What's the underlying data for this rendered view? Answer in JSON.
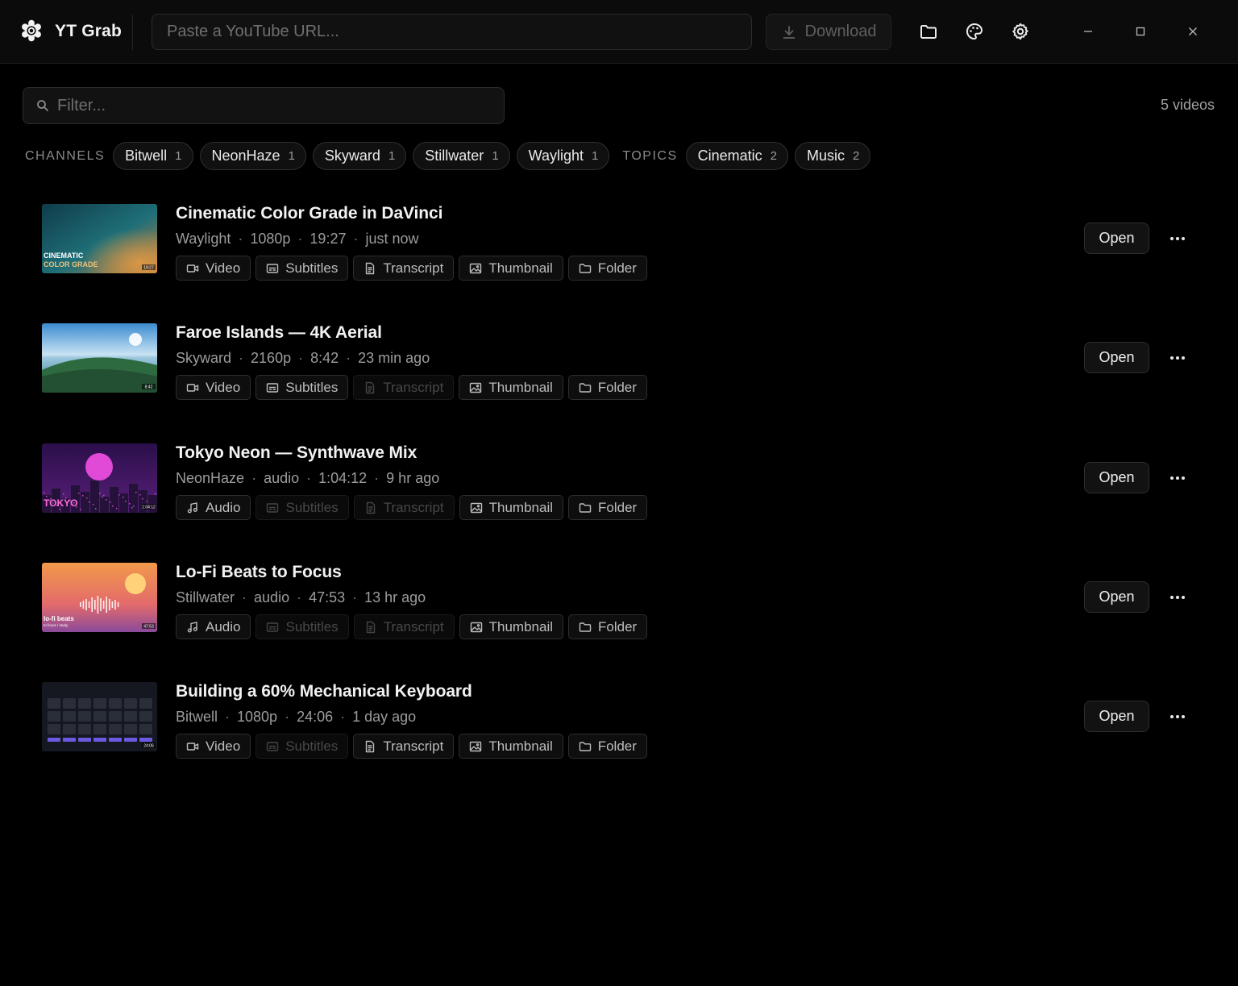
{
  "app": {
    "name": "YT Grab",
    "logo_icon": "gear-flower-logo-icon"
  },
  "toolbar": {
    "url_placeholder": "Paste a YouTube URL...",
    "url_value": "",
    "download_label": "Download",
    "icons": [
      "folder-icon",
      "palette-icon",
      "gear-icon"
    ]
  },
  "window_controls": [
    "minimize-icon",
    "maximize-icon",
    "close-icon"
  ],
  "filter": {
    "placeholder": "Filter...",
    "value": "",
    "count_label": "5 videos"
  },
  "chips": {
    "channels_label": "CHANNELS",
    "channels": [
      {
        "label": "Bitwell",
        "count": "1"
      },
      {
        "label": "NeonHaze",
        "count": "1"
      },
      {
        "label": "Skyward",
        "count": "1"
      },
      {
        "label": "Stillwater",
        "count": "1"
      },
      {
        "label": "Waylight",
        "count": "1"
      }
    ],
    "topics_label": "TOPICS",
    "topics": [
      {
        "label": "Cinematic",
        "count": "2"
      },
      {
        "label": "Music",
        "count": "2"
      }
    ]
  },
  "labels": {
    "open": "Open",
    "thumbnail": "Thumbnail",
    "folder": "Folder",
    "subtitles": "Subtitles",
    "transcript": "Transcript"
  },
  "videos": [
    {
      "title": "Cinematic Color Grade in DaVinci",
      "channel": "Waylight",
      "quality": "1080p",
      "duration": "19:27",
      "added": "just now",
      "media_label": "Video",
      "media_icon": "video-icon",
      "subtitles_enabled": true,
      "transcript_enabled": true,
      "thumb": {
        "style": "cinematic",
        "caption_line1": "CINEMATIC",
        "caption_line2": "COLOR GRADE",
        "badge": "19:27"
      }
    },
    {
      "title": "Faroe Islands — 4K Aerial",
      "channel": "Skyward",
      "quality": "2160p",
      "duration": "8:42",
      "added": "23 min ago",
      "media_label": "Video",
      "media_icon": "video-icon",
      "subtitles_enabled": true,
      "transcript_enabled": false,
      "thumb": {
        "style": "landscape",
        "caption_line1": "",
        "caption_line2": "",
        "badge": "8:42"
      }
    },
    {
      "title": "Tokyo Neon — Synthwave Mix",
      "channel": "NeonHaze",
      "quality": "audio",
      "duration": "1:04:12",
      "added": "9 hr ago",
      "media_label": "Audio",
      "media_icon": "music-note-icon",
      "subtitles_enabled": false,
      "transcript_enabled": false,
      "thumb": {
        "style": "synthwave",
        "caption_line1": "TOKYO",
        "caption_line2": "",
        "badge": "1:04:12"
      }
    },
    {
      "title": "Lo-Fi Beats to Focus",
      "channel": "Stillwater",
      "quality": "audio",
      "duration": "47:53",
      "added": "13 hr ago",
      "media_label": "Audio",
      "media_icon": "music-note-icon",
      "subtitles_enabled": false,
      "transcript_enabled": false,
      "thumb": {
        "style": "lofi",
        "caption_line1": "lo-fi beats",
        "caption_line2": "to focus / study",
        "badge": "47:53"
      }
    },
    {
      "title": "Building a 60% Mechanical Keyboard",
      "channel": "Bitwell",
      "quality": "1080p",
      "duration": "24:06",
      "added": "1 day ago",
      "media_label": "Video",
      "media_icon": "video-icon",
      "subtitles_enabled": false,
      "transcript_enabled": true,
      "thumb": {
        "style": "keyboard",
        "caption_line1": "",
        "caption_line2": "",
        "badge": "24:06"
      }
    }
  ],
  "colors": {
    "background": "#000000",
    "titlebar": "#0b0b0b",
    "text_primary": "#f2f2f2",
    "text_secondary": "#9c9c9c",
    "disabled_text": "#484848"
  }
}
